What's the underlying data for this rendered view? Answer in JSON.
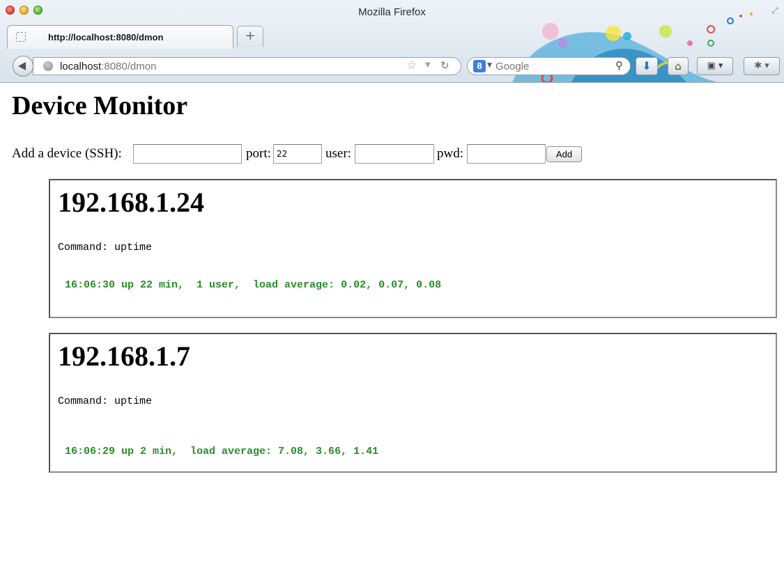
{
  "window": {
    "title": "Mozilla Firefox"
  },
  "tab": {
    "title": "http://localhost:8080/dmon"
  },
  "urlbar": {
    "host": "localhost",
    "rest": ":8080/dmon"
  },
  "search": {
    "engine": "Google"
  },
  "page": {
    "title": "Device Monitor",
    "add_form": {
      "device_label": "Add a device (SSH):",
      "device_value": "",
      "port_label": "port:",
      "port_value": "22",
      "user_label": "user:",
      "user_value": "",
      "pwd_label": "pwd:",
      "pwd_value": "",
      "add_label": "Add"
    },
    "devices": [
      {
        "ip": "192.168.1.24",
        "command_label": "Command:",
        "command": "uptime",
        "output": "16:06:30 up 22 min,  1 user,  load average: 0.02, 0.07, 0.08"
      },
      {
        "ip": "192.168.1.7",
        "command_label": "Command:",
        "command": "uptime",
        "output": "16:06:29 up 2 min,  load average: 7.08, 3.66, 1.41"
      }
    ]
  },
  "icons": {
    "back": "back-arrow-icon",
    "globe": "globe-icon",
    "star": "bookmark-star-icon",
    "reload": "reload-icon",
    "search": "magnifier-icon",
    "download": "download-arrow-icon",
    "home": "home-icon",
    "bookmarks": "bookmarks-menu-icon",
    "tools": "tools-menu-icon"
  },
  "colors": {
    "output_text": "#2a8c2a",
    "accent": "#3c7fe0"
  }
}
